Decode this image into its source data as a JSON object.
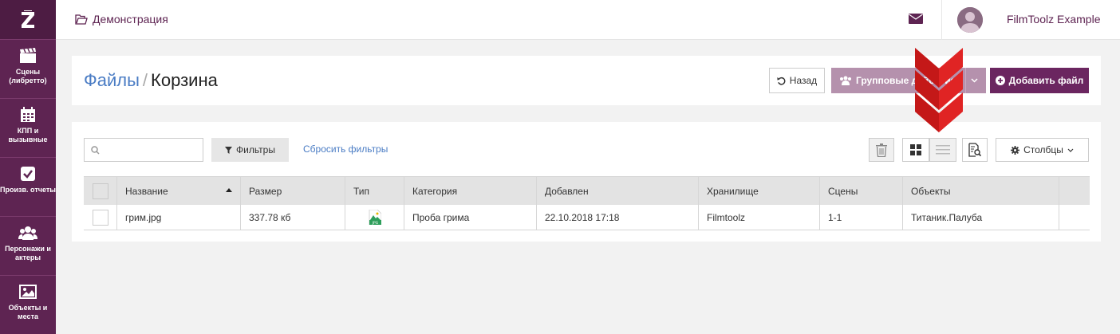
{
  "sidebar": {
    "items": [
      {
        "label": "Сцены (либретто)",
        "icon": "clapperboard-icon"
      },
      {
        "label": "КПП и вызывные",
        "icon": "calendar-icon"
      },
      {
        "label": "Произв. отчеты",
        "icon": "checkbox-icon"
      },
      {
        "label": "Персонажи и актеры",
        "icon": "people-icon"
      },
      {
        "label": "Объекты и места",
        "icon": "picture-icon"
      }
    ]
  },
  "header": {
    "breadcrumb": "Демонстрация",
    "username": "FilmToolz Example"
  },
  "title": {
    "link": "Файлы",
    "separator": "/",
    "current": "Корзина"
  },
  "toolbar": {
    "back_label": "Назад",
    "group_label": "Групповые действия",
    "add_label": "Добавить файл"
  },
  "filters": {
    "search_placeholder": "",
    "filter_label": "Фильтры",
    "reset_label": "Сбросить фильтры",
    "columns_label": "Столбцы"
  },
  "table": {
    "headers": [
      "Название",
      "Размер",
      "Тип",
      "Категория",
      "Добавлен",
      "Хранилище",
      "Сцены",
      "Объекты"
    ],
    "rows": [
      {
        "name": "грим.jpg",
        "size": "337.78 кб",
        "type_icon": "jpg-file-icon",
        "category": "Проба грима",
        "added": "22.10.2018 17:18",
        "storage": "Filmtoolz",
        "scenes": "1-1",
        "objects": "Титаник.Палуба"
      }
    ]
  },
  "colors": {
    "sidebar": "#5e2452",
    "accent": "#6b2660",
    "link": "#4a7cc4",
    "annotation_arrow": "#e02424"
  }
}
